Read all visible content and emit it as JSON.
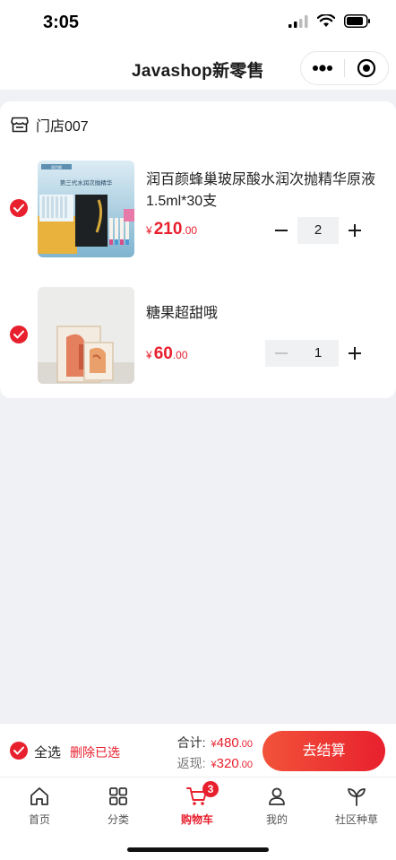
{
  "status": {
    "time": "3:05"
  },
  "nav": {
    "title": "Javashop新零售"
  },
  "store": {
    "name": "门店007"
  },
  "items": [
    {
      "title": "润百颜蜂巢玻尿酸水润次抛精华原液1.5ml*30支",
      "currency": "¥",
      "price_int": "210",
      "price_dec": ".00",
      "quantity": "2",
      "image_caption": "第三代水润次抛精华",
      "image_brand": "润百颜"
    },
    {
      "title": "糖果超甜哦",
      "currency": "¥",
      "price_int": "60",
      "price_dec": ".00",
      "quantity": "1"
    }
  ],
  "checkout": {
    "select_all_label": "全选",
    "delete_label": "删除已选",
    "total_label": "合计:",
    "total_currency": "¥",
    "total_int": "480",
    "total_dec": ".00",
    "cashback_label": "返现:",
    "cashback_currency": "¥",
    "cashback_int": "320",
    "cashback_dec": ".00",
    "button_label": "去结算"
  },
  "tabs": [
    {
      "label": "首页",
      "icon": "home-icon"
    },
    {
      "label": "分类",
      "icon": "category-grid-icon"
    },
    {
      "label": "购物车",
      "icon": "cart-icon",
      "badge": "3",
      "active": true
    },
    {
      "label": "我的",
      "icon": "user-icon"
    },
    {
      "label": "社区种草",
      "icon": "sprout-icon"
    }
  ],
  "colors": {
    "accent": "#e8202e",
    "background": "#f0f1f5"
  }
}
